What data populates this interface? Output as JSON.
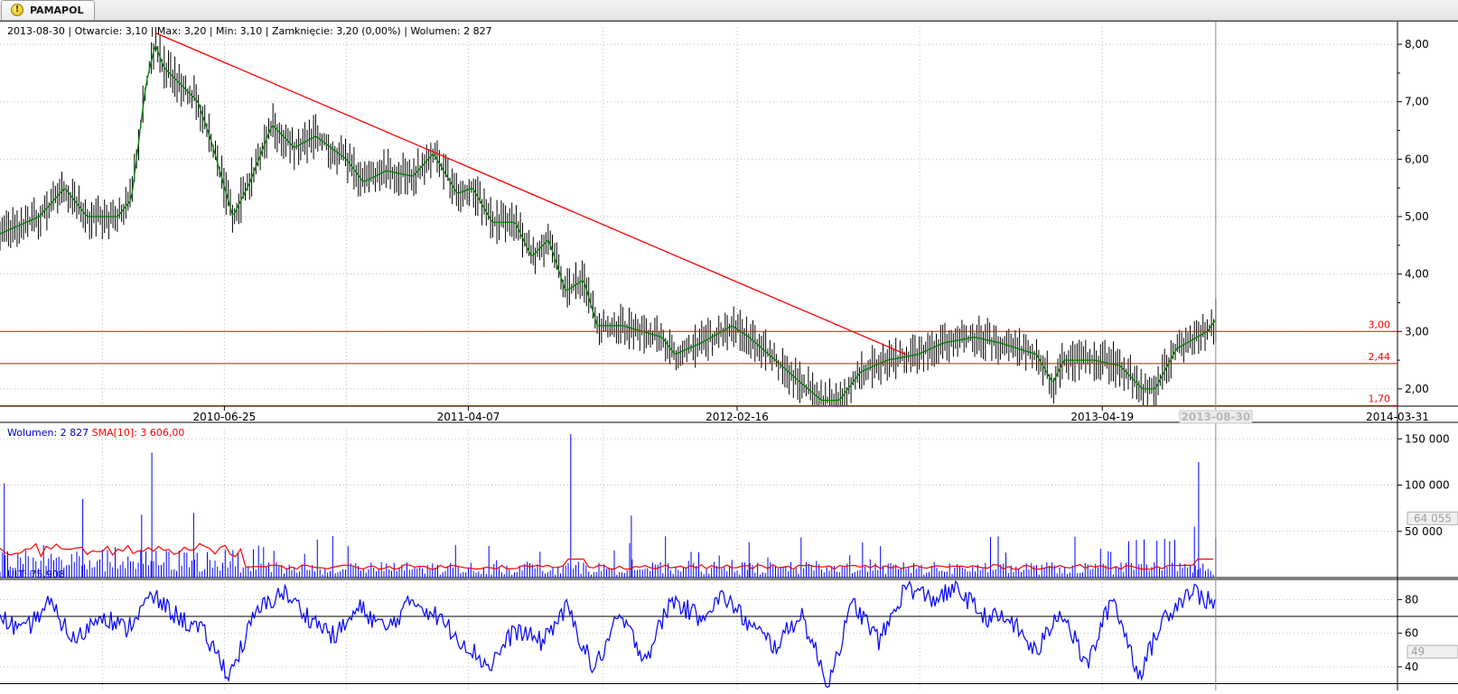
{
  "tab": {
    "title": "PAMAPOL",
    "icon": "warning-icon"
  },
  "info": {
    "date": "2013-08-30",
    "open": "Otwarcie: 3,10",
    "max": "Max: 3,20",
    "min": "Min: 3,10",
    "close": "Zamknięcie: 3,20 (0,00%)",
    "volume": "Wolumen: 2 827"
  },
  "colors": {
    "price_bars": "#000000",
    "ma_line": "#008000",
    "trend_line": "#ff0000",
    "levels": "#ff0000",
    "volume_bars": "#0000ff",
    "sma_line": "#ff0000",
    "ult_line": "#0000ff",
    "grid": "#bdbdbd"
  },
  "chart_data": [
    {
      "type": "ohlc",
      "panel": "price",
      "y_ticks": [
        "8,00",
        "7,00",
        "6,00",
        "5,00",
        "4,00",
        "3,00",
        "2,00"
      ],
      "y_tick_values": [
        8,
        7,
        6,
        5,
        4,
        3,
        2
      ],
      "ylim": [
        1.7,
        8.3
      ],
      "x_ticks": [
        "2010-06-25",
        "2011-04-07",
        "2012-02-16",
        "2013-04-19",
        "2014-03-31"
      ],
      "xlim": [
        "2009-10-05",
        "2014-03-31"
      ],
      "cursor_label": "2013-08-30",
      "grid": true,
      "close_path": [
        [
          "2009-10-05",
          4.7
        ],
        [
          "2009-11-20",
          5.0
        ],
        [
          "2009-12-20",
          5.5
        ],
        [
          "2010-01-15",
          5.0
        ],
        [
          "2010-02-20",
          5.0
        ],
        [
          "2010-03-08",
          5.3
        ],
        [
          "2010-03-25",
          7.3
        ],
        [
          "2010-04-05",
          8.0
        ],
        [
          "2010-04-15",
          7.6
        ],
        [
          "2010-05-05",
          7.3
        ],
        [
          "2010-05-25",
          7.0
        ],
        [
          "2010-06-10",
          6.3
        ],
        [
          "2010-07-05",
          5.0
        ],
        [
          "2010-07-25",
          5.6
        ],
        [
          "2010-08-20",
          6.6
        ],
        [
          "2010-09-15",
          6.2
        ],
        [
          "2010-10-10",
          6.4
        ],
        [
          "2010-11-15",
          6.0
        ],
        [
          "2010-12-05",
          5.6
        ],
        [
          "2011-01-01",
          5.8
        ],
        [
          "2011-02-01",
          5.7
        ],
        [
          "2011-02-25",
          6.1
        ],
        [
          "2011-03-25",
          5.4
        ],
        [
          "2011-04-12",
          5.5
        ],
        [
          "2011-05-05",
          4.9
        ],
        [
          "2011-06-01",
          4.9
        ],
        [
          "2011-06-20",
          4.3
        ],
        [
          "2011-07-10",
          4.6
        ],
        [
          "2011-07-30",
          3.7
        ],
        [
          "2011-08-20",
          3.9
        ],
        [
          "2011-09-05",
          3.1
        ],
        [
          "2011-10-05",
          3.1
        ],
        [
          "2011-11-20",
          2.9
        ],
        [
          "2011-12-05",
          2.6
        ],
        [
          "2012-01-05",
          2.8
        ],
        [
          "2012-02-10",
          3.1
        ],
        [
          "2012-03-01",
          2.9
        ],
        [
          "2012-04-01",
          2.5
        ],
        [
          "2012-05-01",
          2.1
        ],
        [
          "2012-05-25",
          1.8
        ],
        [
          "2012-06-15",
          1.8
        ],
        [
          "2012-07-10",
          2.3
        ],
        [
          "2012-08-10",
          2.5
        ],
        [
          "2012-09-15",
          2.6
        ],
        [
          "2012-10-15",
          2.8
        ],
        [
          "2012-11-20",
          2.9
        ],
        [
          "2012-12-20",
          2.8
        ],
        [
          "2013-02-01",
          2.6
        ],
        [
          "2013-02-20",
          2.1
        ],
        [
          "2013-03-05",
          2.5
        ],
        [
          "2013-04-10",
          2.5
        ],
        [
          "2013-05-10",
          2.4
        ],
        [
          "2013-06-05",
          2.0
        ],
        [
          "2013-06-20",
          2.0
        ],
        [
          "2013-07-15",
          2.7
        ],
        [
          "2013-08-20",
          3.0
        ],
        [
          "2013-08-30",
          3.2
        ]
      ],
      "trendline": [
        [
          "2010-04-05",
          8.2
        ],
        [
          "2012-09-01",
          2.6
        ]
      ],
      "levels": [
        {
          "label": "3,00",
          "value": 3.0
        },
        {
          "label": "2,44",
          "value": 2.44
        },
        {
          "label": "1,70",
          "value": 1.7
        }
      ]
    },
    {
      "type": "bar",
      "panel": "volume",
      "legend_volume": "Wolumen: 2 827",
      "legend_sma": "SMA[10]: 3 606,00",
      "y_ticks": [
        "150 000",
        "100 000",
        "50 000"
      ],
      "y_tick_values": [
        150000,
        100000,
        50000
      ],
      "ylim": [
        0,
        160000
      ],
      "current_label": "64 055",
      "current_value": 64055,
      "spikes": [
        [
          "2009-10-10",
          102000
        ],
        [
          "2010-01-10",
          85000
        ],
        [
          "2010-03-20",
          68000
        ],
        [
          "2010-04-01",
          135000
        ],
        [
          "2010-05-20",
          70000
        ],
        [
          "2011-08-05",
          155000
        ],
        [
          "2011-10-15",
          67000
        ],
        [
          "2012-03-01",
          38000
        ],
        [
          "2013-08-10",
          125000
        ],
        [
          "2013-08-05",
          55000
        ]
      ]
    },
    {
      "type": "line",
      "panel": "ult",
      "legend": "ULT: 75,908",
      "y_ticks": [
        "80",
        "60",
        "40"
      ],
      "y_tick_values": [
        80,
        60,
        40
      ],
      "ylim": [
        26,
        92
      ],
      "current_label": "49",
      "current_value": 49,
      "reference_lines": [
        70,
        30
      ],
      "path": [
        [
          "2009-10-05",
          70
        ],
        [
          "2009-11-01",
          60
        ],
        [
          "2009-12-01",
          78
        ],
        [
          "2010-01-01",
          55
        ],
        [
          "2010-02-01",
          72
        ],
        [
          "2010-03-01",
          62
        ],
        [
          "2010-04-01",
          82
        ],
        [
          "2010-05-01",
          70
        ],
        [
          "2010-06-01",
          60
        ],
        [
          "2010-07-01",
          35
        ],
        [
          "2010-08-01",
          72
        ],
        [
          "2010-09-01",
          85
        ],
        [
          "2010-10-01",
          70
        ],
        [
          "2010-11-01",
          58
        ],
        [
          "2010-12-01",
          75
        ],
        [
          "2011-01-01",
          62
        ],
        [
          "2011-02-01",
          80
        ],
        [
          "2011-03-01",
          70
        ],
        [
          "2011-04-01",
          55
        ],
        [
          "2011-05-01",
          40
        ],
        [
          "2011-06-01",
          62
        ],
        [
          "2011-07-01",
          55
        ],
        [
          "2011-08-01",
          75
        ],
        [
          "2011-09-01",
          38
        ],
        [
          "2011-10-01",
          70
        ],
        [
          "2011-11-01",
          45
        ],
        [
          "2011-12-01",
          80
        ],
        [
          "2012-01-01",
          70
        ],
        [
          "2012-02-01",
          82
        ],
        [
          "2012-03-01",
          65
        ],
        [
          "2012-04-01",
          52
        ],
        [
          "2012-05-01",
          72
        ],
        [
          "2012-06-01",
          30
        ],
        [
          "2012-07-01",
          78
        ],
        [
          "2012-08-01",
          55
        ],
        [
          "2012-09-01",
          88
        ],
        [
          "2012-10-01",
          80
        ],
        [
          "2012-11-01",
          86
        ],
        [
          "2012-12-01",
          70
        ],
        [
          "2013-01-01",
          68
        ],
        [
          "2013-02-01",
          48
        ],
        [
          "2013-03-01",
          75
        ],
        [
          "2013-04-01",
          40
        ],
        [
          "2013-05-01",
          82
        ],
        [
          "2013-06-01",
          35
        ],
        [
          "2013-07-01",
          70
        ],
        [
          "2013-08-01",
          86
        ],
        [
          "2013-08-30",
          76
        ]
      ]
    }
  ]
}
